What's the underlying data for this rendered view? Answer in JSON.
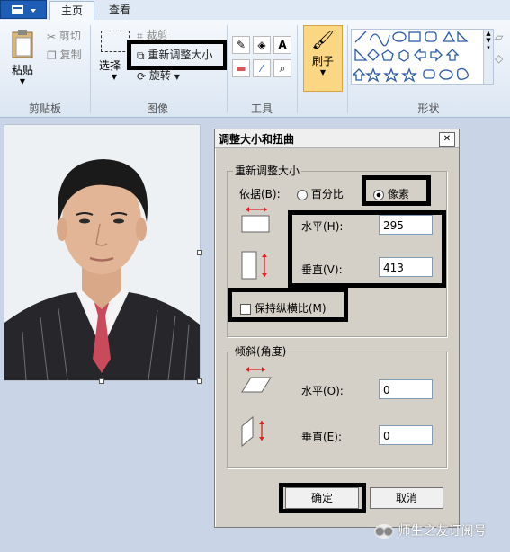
{
  "ribbon": {
    "tabs": [
      "主页",
      "查看"
    ],
    "clipboard": {
      "paste": "粘贴",
      "cut": "剪切",
      "copy": "复制",
      "group": "剪贴板"
    },
    "image": {
      "select": "选择",
      "crop": "裁剪",
      "resize": "重新调整大小",
      "rotate": "旋转",
      "group": "图像"
    },
    "tools": {
      "group": "工具"
    },
    "brush": "刷子",
    "shapes": {
      "group": "形状"
    }
  },
  "dialog": {
    "title": "调整大小和扭曲",
    "close": "✕",
    "resize_group": "重新调整大小",
    "by_label": "依据(B):",
    "percent": "百分比",
    "pixels": "像素",
    "horizontal_label": "水平(H):",
    "horizontal_value": "295",
    "vertical_label": "垂直(V):",
    "vertical_value": "413",
    "keep_ratio": "保持纵横比(M)",
    "skew_group": "倾斜(角度)",
    "skew_h_label": "水平(O):",
    "skew_h_value": "0",
    "skew_v_label": "垂直(E):",
    "skew_v_value": "0",
    "ok": "确定",
    "cancel": "取消"
  },
  "watermark": "师生之友订阅号",
  "colors": {
    "accent": "#1d5db5",
    "brush_bg": "#fbd683",
    "highlight": "#000000",
    "arrow": "#e02020"
  }
}
